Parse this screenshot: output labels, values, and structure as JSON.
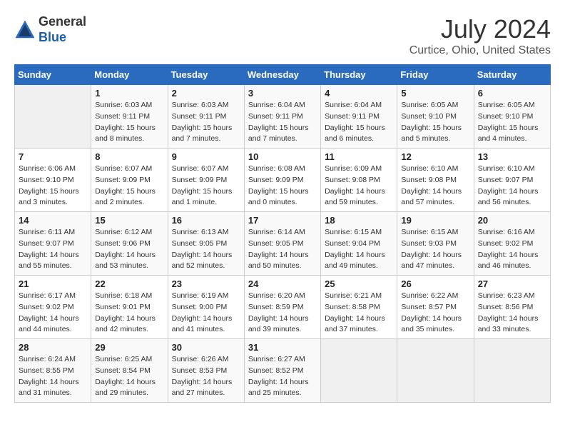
{
  "header": {
    "logo_line1": "General",
    "logo_line2": "Blue",
    "month_year": "July 2024",
    "location": "Curtice, Ohio, United States"
  },
  "weekdays": [
    "Sunday",
    "Monday",
    "Tuesday",
    "Wednesday",
    "Thursday",
    "Friday",
    "Saturday"
  ],
  "weeks": [
    [
      {
        "day": "",
        "info": ""
      },
      {
        "day": "1",
        "info": "Sunrise: 6:03 AM\nSunset: 9:11 PM\nDaylight: 15 hours\nand 8 minutes."
      },
      {
        "day": "2",
        "info": "Sunrise: 6:03 AM\nSunset: 9:11 PM\nDaylight: 15 hours\nand 7 minutes."
      },
      {
        "day": "3",
        "info": "Sunrise: 6:04 AM\nSunset: 9:11 PM\nDaylight: 15 hours\nand 7 minutes."
      },
      {
        "day": "4",
        "info": "Sunrise: 6:04 AM\nSunset: 9:11 PM\nDaylight: 15 hours\nand 6 minutes."
      },
      {
        "day": "5",
        "info": "Sunrise: 6:05 AM\nSunset: 9:10 PM\nDaylight: 15 hours\nand 5 minutes."
      },
      {
        "day": "6",
        "info": "Sunrise: 6:05 AM\nSunset: 9:10 PM\nDaylight: 15 hours\nand 4 minutes."
      }
    ],
    [
      {
        "day": "7",
        "info": "Sunrise: 6:06 AM\nSunset: 9:10 PM\nDaylight: 15 hours\nand 3 minutes."
      },
      {
        "day": "8",
        "info": "Sunrise: 6:07 AM\nSunset: 9:09 PM\nDaylight: 15 hours\nand 2 minutes."
      },
      {
        "day": "9",
        "info": "Sunrise: 6:07 AM\nSunset: 9:09 PM\nDaylight: 15 hours\nand 1 minute."
      },
      {
        "day": "10",
        "info": "Sunrise: 6:08 AM\nSunset: 9:09 PM\nDaylight: 15 hours\nand 0 minutes."
      },
      {
        "day": "11",
        "info": "Sunrise: 6:09 AM\nSunset: 9:08 PM\nDaylight: 14 hours\nand 59 minutes."
      },
      {
        "day": "12",
        "info": "Sunrise: 6:10 AM\nSunset: 9:08 PM\nDaylight: 14 hours\nand 57 minutes."
      },
      {
        "day": "13",
        "info": "Sunrise: 6:10 AM\nSunset: 9:07 PM\nDaylight: 14 hours\nand 56 minutes."
      }
    ],
    [
      {
        "day": "14",
        "info": "Sunrise: 6:11 AM\nSunset: 9:07 PM\nDaylight: 14 hours\nand 55 minutes."
      },
      {
        "day": "15",
        "info": "Sunrise: 6:12 AM\nSunset: 9:06 PM\nDaylight: 14 hours\nand 53 minutes."
      },
      {
        "day": "16",
        "info": "Sunrise: 6:13 AM\nSunset: 9:05 PM\nDaylight: 14 hours\nand 52 minutes."
      },
      {
        "day": "17",
        "info": "Sunrise: 6:14 AM\nSunset: 9:05 PM\nDaylight: 14 hours\nand 50 minutes."
      },
      {
        "day": "18",
        "info": "Sunrise: 6:15 AM\nSunset: 9:04 PM\nDaylight: 14 hours\nand 49 minutes."
      },
      {
        "day": "19",
        "info": "Sunrise: 6:15 AM\nSunset: 9:03 PM\nDaylight: 14 hours\nand 47 minutes."
      },
      {
        "day": "20",
        "info": "Sunrise: 6:16 AM\nSunset: 9:02 PM\nDaylight: 14 hours\nand 46 minutes."
      }
    ],
    [
      {
        "day": "21",
        "info": "Sunrise: 6:17 AM\nSunset: 9:02 PM\nDaylight: 14 hours\nand 44 minutes."
      },
      {
        "day": "22",
        "info": "Sunrise: 6:18 AM\nSunset: 9:01 PM\nDaylight: 14 hours\nand 42 minutes."
      },
      {
        "day": "23",
        "info": "Sunrise: 6:19 AM\nSunset: 9:00 PM\nDaylight: 14 hours\nand 41 minutes."
      },
      {
        "day": "24",
        "info": "Sunrise: 6:20 AM\nSunset: 8:59 PM\nDaylight: 14 hours\nand 39 minutes."
      },
      {
        "day": "25",
        "info": "Sunrise: 6:21 AM\nSunset: 8:58 PM\nDaylight: 14 hours\nand 37 minutes."
      },
      {
        "day": "26",
        "info": "Sunrise: 6:22 AM\nSunset: 8:57 PM\nDaylight: 14 hours\nand 35 minutes."
      },
      {
        "day": "27",
        "info": "Sunrise: 6:23 AM\nSunset: 8:56 PM\nDaylight: 14 hours\nand 33 minutes."
      }
    ],
    [
      {
        "day": "28",
        "info": "Sunrise: 6:24 AM\nSunset: 8:55 PM\nDaylight: 14 hours\nand 31 minutes."
      },
      {
        "day": "29",
        "info": "Sunrise: 6:25 AM\nSunset: 8:54 PM\nDaylight: 14 hours\nand 29 minutes."
      },
      {
        "day": "30",
        "info": "Sunrise: 6:26 AM\nSunset: 8:53 PM\nDaylight: 14 hours\nand 27 minutes."
      },
      {
        "day": "31",
        "info": "Sunrise: 6:27 AM\nSunset: 8:52 PM\nDaylight: 14 hours\nand 25 minutes."
      },
      {
        "day": "",
        "info": ""
      },
      {
        "day": "",
        "info": ""
      },
      {
        "day": "",
        "info": ""
      }
    ]
  ]
}
